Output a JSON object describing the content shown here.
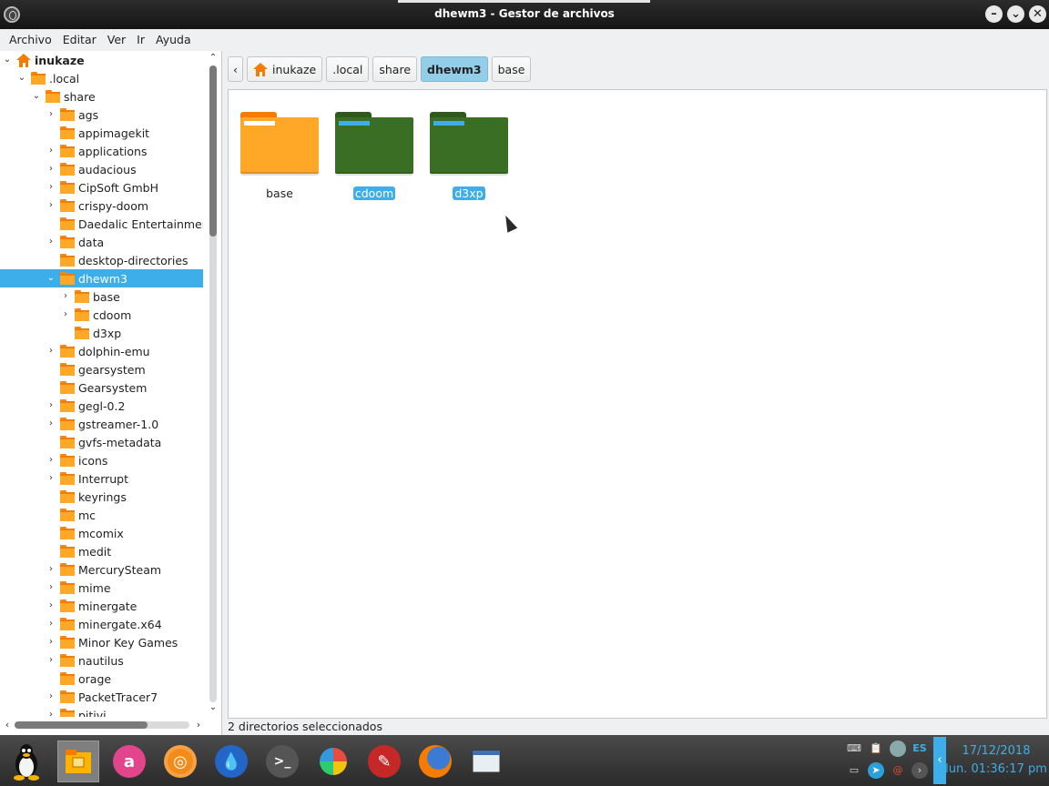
{
  "window": {
    "title": "dhewm3 - Gestor de archivos",
    "controls": [
      "minimize-icon",
      "maximize-icon",
      "close-icon"
    ]
  },
  "menu": [
    "Archivo",
    "Editar",
    "Ver",
    "Ir",
    "Ayuda"
  ],
  "tree": {
    "root": "inukaze",
    "local": ".local",
    "share": "share",
    "children": [
      {
        "label": "ags",
        "expandable": true
      },
      {
        "label": "appimagekit",
        "expandable": false
      },
      {
        "label": "applications",
        "expandable": true
      },
      {
        "label": "audacious",
        "expandable": true
      },
      {
        "label": "CipSoft GmbH",
        "expandable": true
      },
      {
        "label": "crispy-doom",
        "expandable": true
      },
      {
        "label": "Daedalic Entertainment",
        "expandable": false
      },
      {
        "label": "data",
        "expandable": true
      },
      {
        "label": "desktop-directories",
        "expandable": false
      },
      {
        "label": "dhewm3",
        "expandable": true,
        "expanded": true,
        "selected": true,
        "children": [
          {
            "label": "base",
            "expandable": true
          },
          {
            "label": "cdoom",
            "expandable": true
          },
          {
            "label": "d3xp",
            "expandable": false
          }
        ]
      },
      {
        "label": "dolphin-emu",
        "expandable": true
      },
      {
        "label": "gearsystem",
        "expandable": false
      },
      {
        "label": "Gearsystem",
        "expandable": false
      },
      {
        "label": "gegl-0.2",
        "expandable": true
      },
      {
        "label": "gstreamer-1.0",
        "expandable": true
      },
      {
        "label": "gvfs-metadata",
        "expandable": false
      },
      {
        "label": "icons",
        "expandable": true
      },
      {
        "label": "Interrupt",
        "expandable": true
      },
      {
        "label": "keyrings",
        "expandable": false
      },
      {
        "label": "mc",
        "expandable": false
      },
      {
        "label": "mcomix",
        "expandable": false
      },
      {
        "label": "medit",
        "expandable": false
      },
      {
        "label": "MercurySteam",
        "expandable": true
      },
      {
        "label": "mime",
        "expandable": true
      },
      {
        "label": "minergate",
        "expandable": true
      },
      {
        "label": "minergate.x64",
        "expandable": true
      },
      {
        "label": "Minor Key Games",
        "expandable": true
      },
      {
        "label": "nautilus",
        "expandable": true
      },
      {
        "label": "orage",
        "expandable": false
      },
      {
        "label": "PacketTracer7",
        "expandable": true
      },
      {
        "label": "pitivi",
        "expandable": true
      }
    ]
  },
  "pathbar": {
    "back_icon": "chevron-left-icon",
    "crumbs": [
      "inukaze",
      ".local",
      "share",
      "dhewm3",
      "base"
    ],
    "active_index": 3
  },
  "content": {
    "items": [
      {
        "label": "base",
        "color": "#ffa726",
        "tab_color": "#f57c00",
        "stripe": "#fff",
        "selected": false
      },
      {
        "label": "cdoom",
        "color": "#3a6e24",
        "tab_color": "#2e5a1c",
        "stripe": "#3daee9",
        "selected": true
      },
      {
        "label": "d3xp",
        "color": "#3a6e24",
        "tab_color": "#2e5a1c",
        "stripe": "#3daee9",
        "selected": true
      }
    ]
  },
  "status": "2 directorios seleccionados",
  "taskbar": {
    "apps": [
      "tux-icon",
      "file-manager-icon",
      "app-a-icon",
      "audio-icon",
      "drop-icon",
      "terminal-icon",
      "pinwheel-icon",
      "pen-icon",
      "firefox-icon",
      "window-icon"
    ],
    "tray": [
      "keyboard-icon",
      "clipboard-icon",
      "avatar-icon",
      "ES",
      "screen-icon",
      "telegram-icon",
      "swirl-icon",
      "terminal-small-icon"
    ],
    "date": "17/12/2018",
    "time": "lun. 01:36:17 pm"
  },
  "colors": {
    "accent": "#3daee9",
    "folder_orange": "#ffa726",
    "folder_green": "#3a6e24"
  }
}
